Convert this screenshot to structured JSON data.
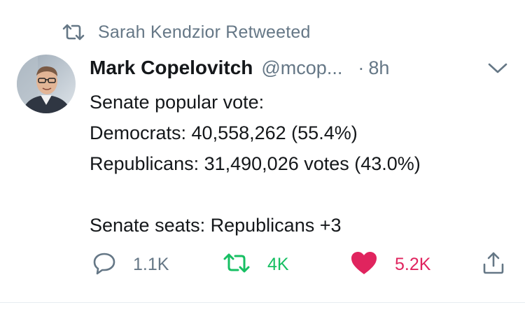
{
  "retweet_context": {
    "text": "Sarah Kendzior Retweeted",
    "icon": "retweet-icon"
  },
  "tweet": {
    "author_name": "Mark Copelovitch",
    "handle": "@mcop...",
    "separator": "·",
    "time": "8h",
    "body_lines": [
      "Senate popular vote:",
      "Democrats: 40,558,262 (55.4%)",
      "Republicans: 31,490,026 votes (43.0%)",
      "",
      "Senate seats: Republicans +3"
    ],
    "actions": {
      "reply_count": "1.1K",
      "retweet_count": "4K",
      "like_count": "5.2K"
    }
  },
  "colors": {
    "text": "#14171a",
    "muted": "#657786",
    "retweet_green": "#17bf63",
    "like_red": "#e0245e",
    "divider": "#e6ecf0"
  }
}
